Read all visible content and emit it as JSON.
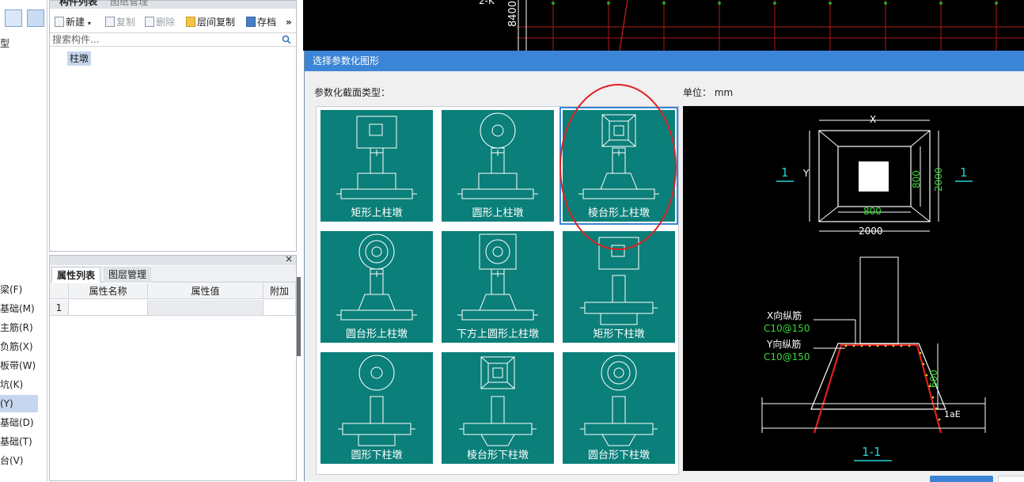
{
  "left_strip": {
    "partial_top_label": "型",
    "categories": [
      {
        "label": "梁(F)",
        "active": false
      },
      {
        "label": "基础(M)",
        "active": false
      },
      {
        "label": "主筋(R)",
        "active": false
      },
      {
        "label": "负筋(X)",
        "active": false
      },
      {
        "label": "板带(W)",
        "active": false
      },
      {
        "label": "坑(K)",
        "active": false
      },
      {
        "label": "(Y)",
        "active": true
      },
      {
        "label": "基础(D)",
        "active": false
      },
      {
        "label": "基础(T)",
        "active": false
      },
      {
        "label": "台(V)",
        "active": false
      }
    ]
  },
  "component_panel": {
    "tabs": [
      "构件列表",
      "图纸管理"
    ],
    "toolbar": {
      "new_label": "新建",
      "copy_label": "复制",
      "delete_label": "删除",
      "floor_copy_label": "层间复制",
      "save_label": "存档",
      "more_label": "»"
    },
    "search_placeholder": "搜索构件...",
    "tree_item": "柱墩"
  },
  "property_panel": {
    "close_glyph": "×",
    "tabs": [
      "属性列表",
      "图层管理"
    ],
    "columns": [
      "属性名称",
      "属性值",
      "附加"
    ],
    "rows": [
      {
        "index": "1",
        "name": "",
        "value": "",
        "extra": ""
      }
    ]
  },
  "cad_background": {
    "labels": [
      "2-K",
      "8400"
    ],
    "colors": {
      "grid": "#b01818",
      "dim": "#ffffff",
      "text": "#ffffff",
      "axis_dot": "#2aa02a"
    }
  },
  "dialog": {
    "title": "选择参数化图形",
    "section_type_label": "参数化截面类型：",
    "unit_label": "单位：",
    "unit_value": "mm",
    "shapes": [
      {
        "label": "矩形上柱墩",
        "icon": "rect-top-pier-icon",
        "selected": false
      },
      {
        "label": "圆形上柱墩",
        "icon": "round-top-pier-icon",
        "selected": false
      },
      {
        "label": "棱台形上柱墩",
        "icon": "frustum-top-pier-icon",
        "selected": true
      },
      {
        "label": "圆台形上柱墩",
        "icon": "round-frustum-top-pier-icon",
        "selected": false
      },
      {
        "label": "下方上圆形上柱墩",
        "icon": "square-bottom-round-top-pier-icon",
        "selected": false
      },
      {
        "label": "矩形下柱墩",
        "icon": "rect-bottom-pier-icon",
        "selected": false
      },
      {
        "label": "圆形下柱墩",
        "icon": "round-bottom-pier-icon",
        "selected": false
      },
      {
        "label": "棱台形下柱墩",
        "icon": "frustum-bottom-pier-icon",
        "selected": false
      },
      {
        "label": "圆台形下柱墩",
        "icon": "round-frustum-bottom-pier-icon",
        "selected": false
      }
    ],
    "preview": {
      "dim_x": "X",
      "dim_y": "Y",
      "dim_800_h": "800",
      "dim_800_v": "800",
      "dim_2000_h": "2000",
      "dim_2000_v": "2000",
      "section_mark_left": "1",
      "section_mark_right": "1",
      "x_rebar_label": "X向纵筋",
      "x_rebar_value": "C10@150",
      "y_rebar_label": "Y向纵筋",
      "y_rebar_value": "C10@150",
      "dim_600": "600",
      "lae": "1aE",
      "section_title": "1-1",
      "colors": {
        "tile": "#0b7f79",
        "preview_bg": "#000000",
        "cyan": "#27d3d3",
        "green": "#38d838",
        "red": "#e02020",
        "yellow_dot": "#f0d020"
      }
    }
  },
  "annotation": {
    "color": "#e02020"
  }
}
